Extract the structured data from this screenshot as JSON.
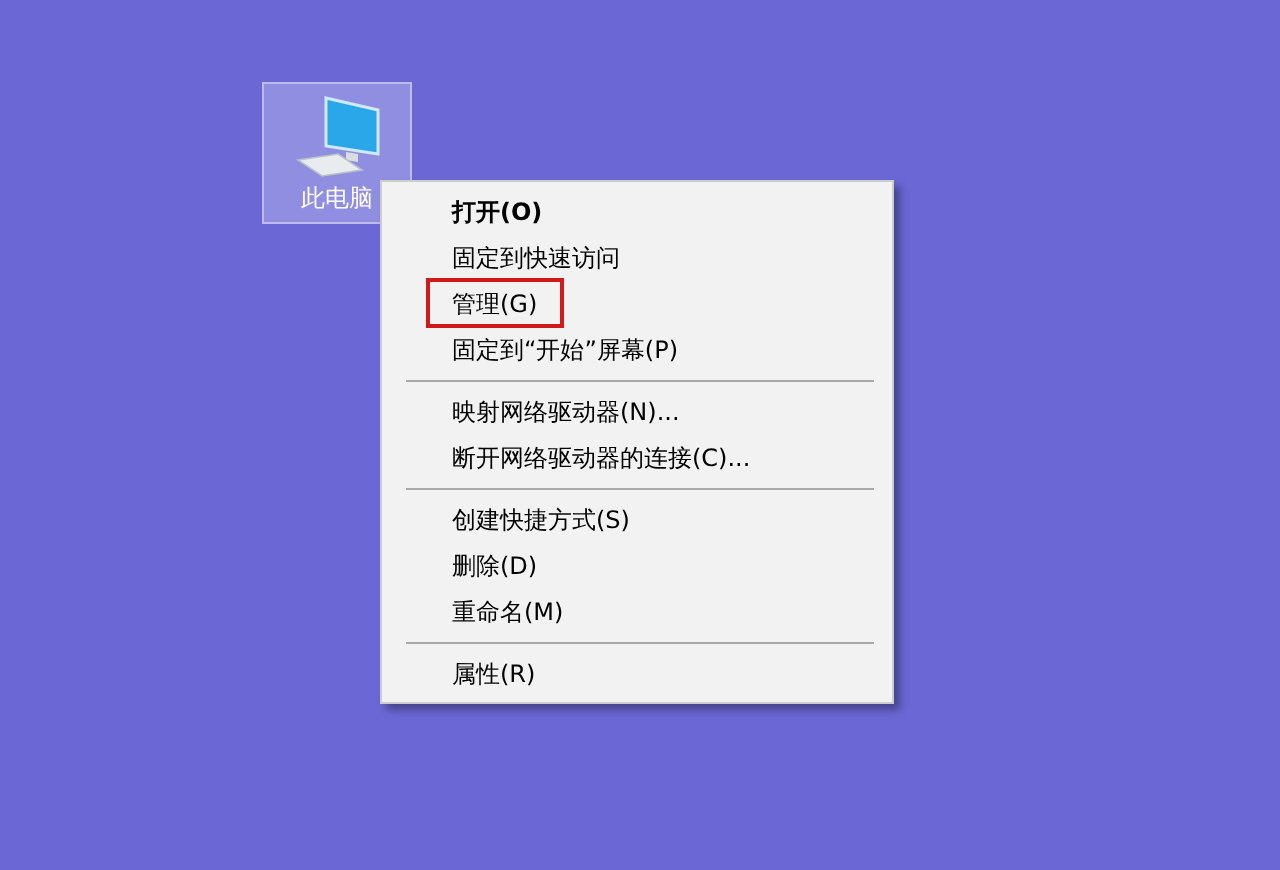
{
  "desktop_icon": {
    "label": "此电脑",
    "selected": true
  },
  "context_menu": {
    "items": [
      {
        "kind": "item",
        "label": "打开(O)",
        "default": true,
        "highlighted": false
      },
      {
        "kind": "item",
        "label": "固定到快速访问",
        "default": false,
        "highlighted": false
      },
      {
        "kind": "item",
        "label": "管理(G)",
        "default": false,
        "highlighted": true
      },
      {
        "kind": "item",
        "label": "固定到“开始”屏幕(P)",
        "default": false,
        "highlighted": false
      },
      {
        "kind": "separator"
      },
      {
        "kind": "item",
        "label": "映射网络驱动器(N)...",
        "default": false,
        "highlighted": false
      },
      {
        "kind": "item",
        "label": "断开网络驱动器的连接(C)...",
        "default": false,
        "highlighted": false
      },
      {
        "kind": "separator"
      },
      {
        "kind": "item",
        "label": "创建快捷方式(S)",
        "default": false,
        "highlighted": false
      },
      {
        "kind": "item",
        "label": "删除(D)",
        "default": false,
        "highlighted": false
      },
      {
        "kind": "item",
        "label": "重命名(M)",
        "default": false,
        "highlighted": false
      },
      {
        "kind": "separator"
      },
      {
        "kind": "item",
        "label": "属性(R)",
        "default": false,
        "highlighted": false
      }
    ]
  }
}
